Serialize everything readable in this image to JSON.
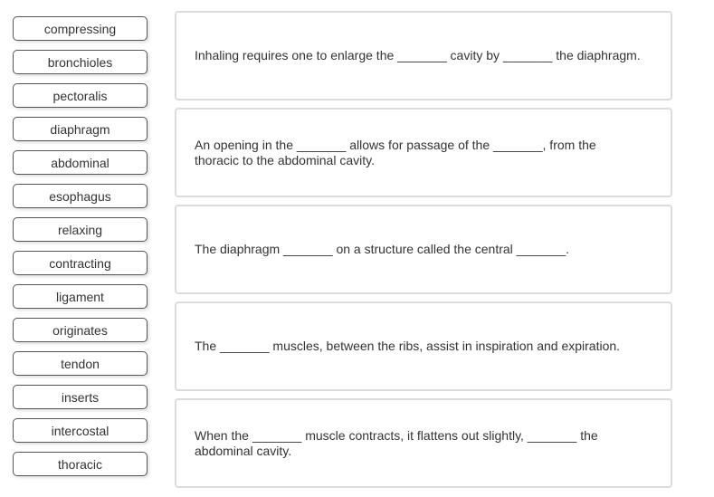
{
  "word_bank": {
    "items": [
      {
        "label": "compressing"
      },
      {
        "label": "bronchioles"
      },
      {
        "label": "pectoralis"
      },
      {
        "label": "diaphragm"
      },
      {
        "label": "abdominal"
      },
      {
        "label": "esophagus"
      },
      {
        "label": "relaxing"
      },
      {
        "label": "contracting"
      },
      {
        "label": "ligament"
      },
      {
        "label": "originates"
      },
      {
        "label": "tendon"
      },
      {
        "label": "inserts"
      },
      {
        "label": "intercostal"
      },
      {
        "label": "thoracic"
      }
    ]
  },
  "statements": {
    "items": [
      {
        "text": "Inhaling requires one to enlarge the _______ cavity by _______ the diaphragm."
      },
      {
        "text": "An opening in the _______ allows for passage of the _______, from the thoracic to the abdominal cavity."
      },
      {
        "text": "The diaphragm _______ on a structure called the central _______."
      },
      {
        "text": "The _______ muscles, between the ribs, assist in inspiration and expiration."
      },
      {
        "text": "When the _______ muscle contracts, it flattens out slightly, _______ the abdominal cavity."
      }
    ]
  },
  "colors": {
    "tile_border": "#555555",
    "card_border": "#dcdcdc",
    "text": "#333333",
    "background": "#ffffff"
  }
}
